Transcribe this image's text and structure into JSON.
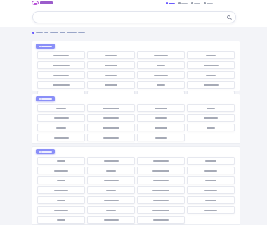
{
  "brand": {
    "accent": "#6b5cff",
    "logo_color": "#b64fd6",
    "tag_color": "#8a8ff8"
  },
  "nav": [
    {
      "icon": "home-icon",
      "label": "",
      "active": true
    },
    {
      "icon": "grid-icon",
      "label": "",
      "active": false
    },
    {
      "icon": "book-icon",
      "label": "",
      "active": false
    },
    {
      "icon": "user-icon",
      "label": "",
      "active": false
    }
  ],
  "search": {
    "placeholder": "",
    "value": "",
    "button_icon": "search-icon"
  },
  "breadcrumb": {
    "icon": "home-icon",
    "items": [
      "",
      "",
      "",
      "",
      "",
      ""
    ]
  },
  "sections": [
    {
      "title": "",
      "items": [
        "",
        "",
        "",
        "",
        "",
        "",
        "",
        "",
        "",
        "",
        "",
        "",
        "",
        "",
        "",
        "",
        "",
        "",
        "",
        ""
      ]
    },
    {
      "title": "",
      "items": [
        "",
        "",
        "",
        "",
        "",
        "",
        "",
        "",
        "",
        "",
        "",
        "",
        "",
        "",
        ""
      ]
    },
    {
      "title": "",
      "items": [
        "",
        "",
        "",
        "",
        "",
        "",
        "",
        "",
        "",
        "",
        "",
        "",
        "",
        "",
        "",
        "",
        "",
        "",
        "",
        "",
        "",
        "",
        "",
        "",
        "",
        "",
        ""
      ]
    }
  ]
}
